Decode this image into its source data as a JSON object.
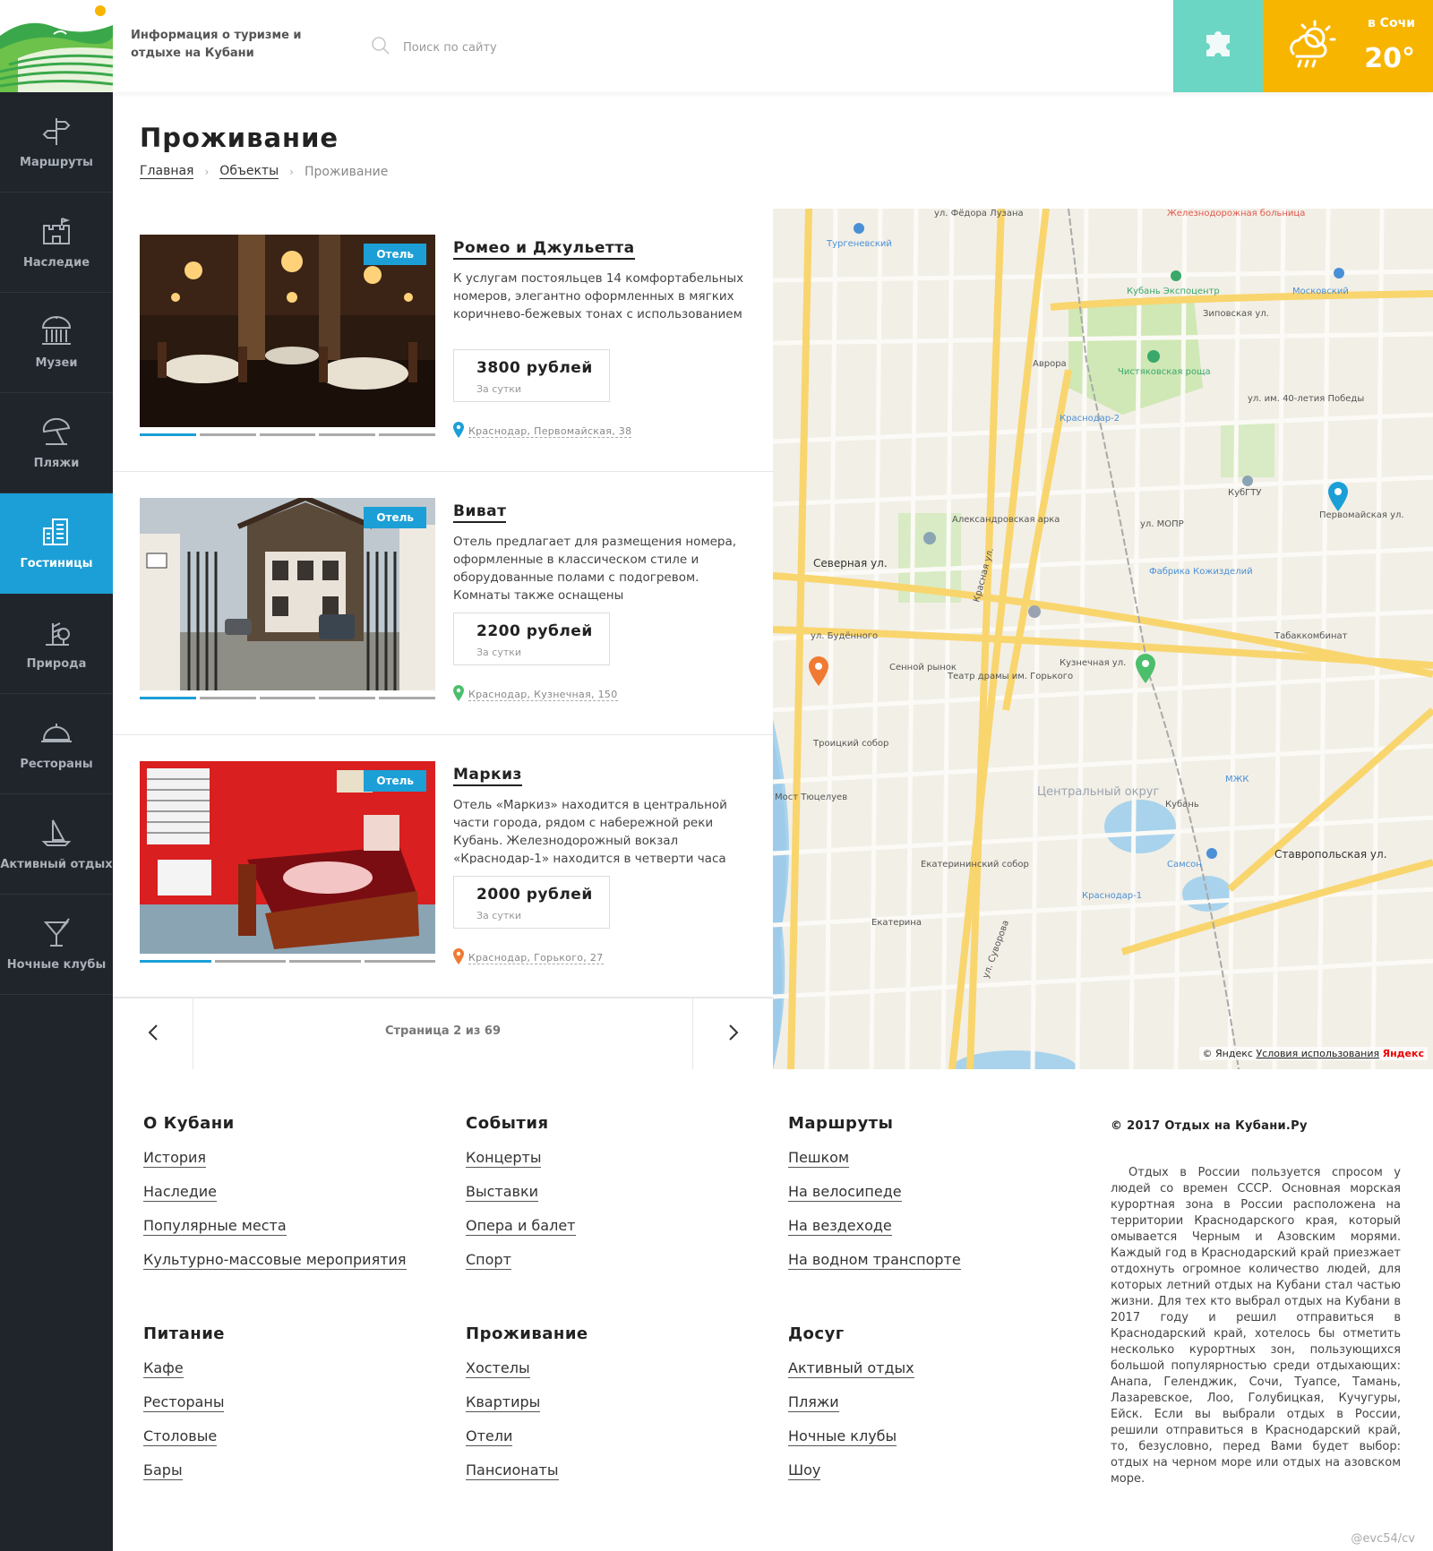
{
  "header": {
    "tagline": "Информация о туризме и отдыхе на Кубани",
    "search_placeholder": "Поиск по сайту",
    "weather_city": "в Сочи",
    "weather_temp": "20°",
    "colors": {
      "puzzle_bg": "#6ad6c3",
      "weather_bg": "#f7b500",
      "accent": "#1c9fd6"
    }
  },
  "sidebar": {
    "items": [
      {
        "label": "Маршруты",
        "icon": "signpost-icon",
        "active": false
      },
      {
        "label": "Наследие",
        "icon": "castle-icon",
        "active": false
      },
      {
        "label": "Музеи",
        "icon": "museum-icon",
        "active": false
      },
      {
        "label": "Пляжи",
        "icon": "umbrella-icon",
        "active": false
      },
      {
        "label": "Гостиницы",
        "icon": "hotel-icon",
        "active": true
      },
      {
        "label": "Природа",
        "icon": "tree-icon",
        "active": false
      },
      {
        "label": "Рестораны",
        "icon": "cloche-icon",
        "active": false
      },
      {
        "label": "Активный отдых",
        "icon": "sailboat-icon",
        "active": false
      },
      {
        "label": "Ночные клубы",
        "icon": "cocktail-icon",
        "active": false
      }
    ]
  },
  "page": {
    "title": "Проживание",
    "breadcrumbs": [
      "Главная",
      "Объекты",
      "Проживание"
    ]
  },
  "listings": [
    {
      "title": "Ромео и Джульетта",
      "badge": "Отель",
      "description": "К услугам постояльцев 14 комфортабельных номеров, элегантно оформленных в мягких коричнево-бежевых тонах с использованием",
      "price": "3800 рублей",
      "price_note": "За сутки",
      "address": "Краснодар, Первомайская, 38",
      "pin_color": "#1c9fd6"
    },
    {
      "title": "Виват",
      "badge": "Отель",
      "description": "Отель предлагает для размещения номера, оформленные в классическом стиле и оборудованные полами с подогревом. Комнаты также оснащены",
      "price": "2200 рублей",
      "price_note": "За сутки",
      "address": "Краснодар, Кузнечная, 150",
      "pin_color": "#4cbf6c"
    },
    {
      "title": "Маркиз",
      "badge": "Отель",
      "description": "Отель «Маркиз» находится в центральной части города, рядом с набережной реки Кубань. Железнодорожный вокзал «Краснодар-1» находится в четверти часа",
      "price": "2000 рублей",
      "price_note": "За сутки",
      "address": "Краснодар, Горького, 27",
      "pin_color": "#f07a32"
    }
  ],
  "pagination": {
    "text": "Страница 2 из 69"
  },
  "map": {
    "labels": {
      "street1": "ул. Фёдора Лузана",
      "street2": "Железнодорожная больница",
      "p1": "Тургеневский",
      "p2": "Кубань Экспоцентр",
      "p3": "Московский",
      "p4": "Зиповская ул.",
      "p5": "Чистяковская роща",
      "p6": "Аврора",
      "p7": "Краснодар-2",
      "p8": "ул. им. 40-летия Победы",
      "p9": "КубГТУ",
      "p10": "Первомайская ул.",
      "p11": "Александровская арка",
      "p12": "Красная ул.",
      "p13": "Северная ул.",
      "p14": "ул. Будённого",
      "p15": "Сенной рынок",
      "p16": "Театр драмы им. Горького",
      "p17": "ул. МОПР",
      "p18": "Фабрика Кожизделий",
      "p19": "Табаккомбинат",
      "p20": "Кузнечная ул.",
      "p21": "Троицкий собор",
      "p22": "Центральный округ",
      "p23": "Кубань",
      "p24": "МЖК",
      "p25": "Самсон",
      "p26": "Екатерининский собор",
      "p27": "Краснодар-1",
      "p28": "Ставропольская ул.",
      "p29": "Екатерина",
      "p30": "ул. Суворова",
      "p31": "Мост Тюцелуев"
    },
    "copyright": "© Яндекс",
    "terms": "Условия использования",
    "provider": "Яндекс"
  },
  "footer": {
    "columns": [
      {
        "heading": "О Кубани",
        "links": [
          "История",
          "Наследие",
          "Популярные места",
          "Культурно-массовые мероприятия"
        ]
      },
      {
        "heading": "События",
        "links": [
          "Концерты",
          "Выставки",
          "Опера и балет",
          "Спорт"
        ]
      },
      {
        "heading": "Маршруты",
        "links": [
          "Пешком",
          "На велосипеде",
          "На вездеходе",
          "На водном транспорте"
        ]
      },
      {
        "heading": "Питание",
        "links": [
          "Кафе",
          "Рестораны",
          "Столовые",
          "Бары"
        ]
      },
      {
        "heading": "Проживание",
        "links": [
          "Хостелы",
          "Квартиры",
          "Отели",
          "Пансионаты"
        ]
      },
      {
        "heading": "Досуг",
        "links": [
          "Активный отдых",
          "Пляжи",
          "Ночные клубы",
          "Шоу"
        ]
      }
    ],
    "copyright": "© 2017 Отдых на Кубани.Ру",
    "about_text": "Отдых в России пользуется спросом у людей со времен СССР. Основная морская курортная зона в России расположена на территории Краснодарского края, который омывается Черным и Азовским морями. Каждый год в Краснодарский край приезжает отдохнуть огромное количество людей, для которых летний отдых на Кубани стал частью жизни. Для тех кто выбрал отдых на Кубани в 2017 году и решил отправиться в Краснодарский край, хотелось бы отметить несколько курортных зон, пользующихся большой популярностью среди отдыхающих: Анапа, Геленджик, Сочи, Туапсе, Тамань, Лазаревское, Лоо, Голубицкая, Кучугуры, Ейск. Если вы выбрали отдых в России, решили отправиться в Краснодарский край, то, безусловно, перед Вами будет выбор: отдых на черном море или отдых на азовском море.",
    "watermark": "@evc54/cv"
  }
}
